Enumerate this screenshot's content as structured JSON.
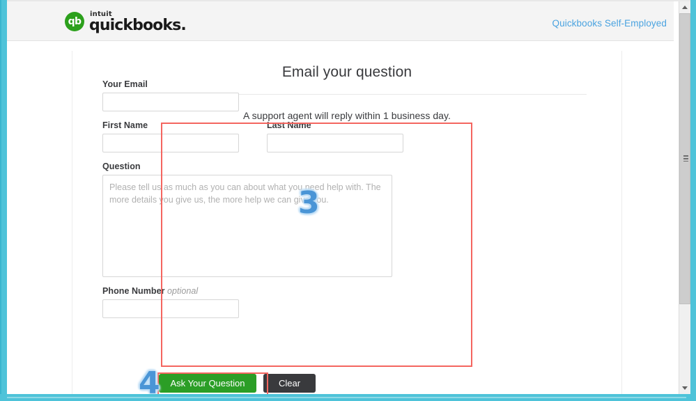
{
  "window": {
    "frame_color": "#4ec3d9"
  },
  "header": {
    "brand": {
      "mark_glyph": "qb",
      "mark_color": "#2ca01c",
      "intuit_text": "intuit",
      "product_text": "quickbooks."
    },
    "link_label": "Quickbooks Self-Employed"
  },
  "page": {
    "title": "Email your question",
    "subtitle": "A support agent will reply within 1 business day."
  },
  "form": {
    "email": {
      "label": "Your Email",
      "value": "",
      "placeholder": ""
    },
    "first_name": {
      "label": "First Name",
      "value": "",
      "placeholder": ""
    },
    "last_name": {
      "label": "Last Name",
      "value": "",
      "placeholder": ""
    },
    "question": {
      "label": "Question",
      "value": "",
      "placeholder": "Please tell us as much as you can about what you need help with. The more details you give us, the more help we can give you."
    },
    "phone": {
      "label": "Phone Number",
      "optional_text": "optional",
      "value": "",
      "placeholder": ""
    }
  },
  "buttons": {
    "submit_label": "Ask Your Question",
    "submit_color": "#2b9e26",
    "clear_label": "Clear",
    "clear_color": "#393a3d"
  },
  "annotations": {
    "highlight_color": "#f4655f",
    "number_color": "#4a95d6",
    "step_three": "3",
    "step_four": "4"
  },
  "scrollbar": {
    "up_arrow": "▲",
    "down_arrow": "▼"
  }
}
